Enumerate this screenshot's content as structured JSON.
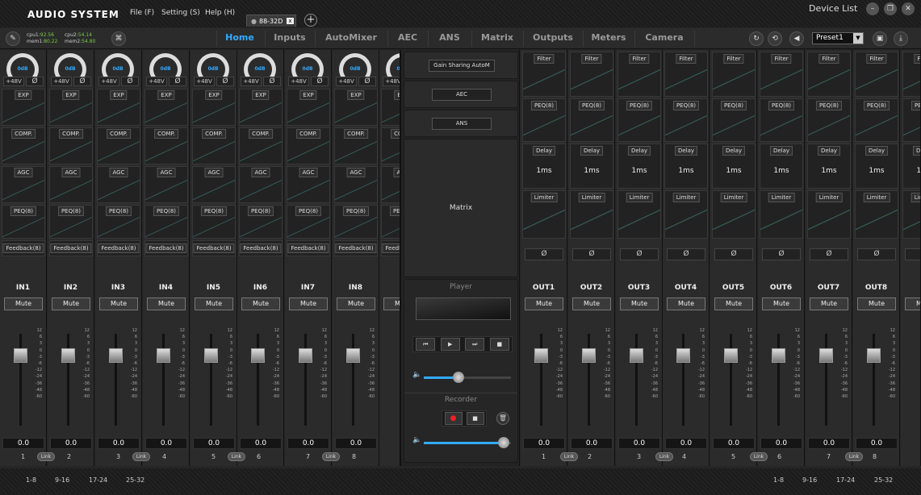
{
  "app": {
    "title": "AUDIO SYSTEM",
    "menu": [
      "File (F)",
      "Setting (S)",
      "Help (H)"
    ],
    "device_tab": "88-32D",
    "device_list": "Device List"
  },
  "toolbar": {
    "cpu1_label": "cpu1:",
    "cpu1": "92.56",
    "cpu2_label": "cpu2:",
    "cpu2": "54.14",
    "mem1_label": "mem1:",
    "mem1": "80.22",
    "mem2_label": "mem2:",
    "mem2": "54.80",
    "preset": "Preset1"
  },
  "nav": [
    "Home",
    "Inputs",
    "AutoMixer",
    "AEC",
    "ANS",
    "Matrix",
    "Outputs",
    "Meters",
    "Camera"
  ],
  "inputs": {
    "gain_label": "0dB",
    "phantom": "+48V",
    "phase": "Ø",
    "modules": [
      "EXP",
      "COMP.",
      "AGC",
      "PEQ(8)",
      "Feedback(8)"
    ],
    "mute": "Mute",
    "value": "0.0",
    "link": "Link",
    "channels": [
      "IN1",
      "IN2",
      "IN3",
      "IN4",
      "IN5",
      "IN6",
      "IN7",
      "IN8"
    ]
  },
  "outputs": {
    "modules": [
      "Filter",
      "PEQ(8)",
      "Delay",
      "Limiter"
    ],
    "delay_value": "1ms",
    "phase": "Ø",
    "mute": "Mute",
    "value": "0.0",
    "link": "Link",
    "channels": [
      "OUT1",
      "OUT2",
      "OUT3",
      "OUT4",
      "OUT5",
      "OUT6",
      "OUT7",
      "OUT8"
    ]
  },
  "fader_scale": [
    "12",
    "6",
    "3",
    "0",
    "-3",
    "-6",
    "-12",
    "-24",
    "-36",
    "-48",
    "-60"
  ],
  "numbers": [
    "1",
    "2",
    "3",
    "4",
    "5",
    "6",
    "7",
    "8"
  ],
  "center": {
    "gain_sharing": "Gain Sharing AutoM",
    "aec": "AEC",
    "ans": "ANS",
    "matrix": "Matrix",
    "player": "Player",
    "recorder": "Recorder",
    "player_volume": 0.4,
    "recorder_volume": 0.92
  },
  "pages": [
    "1-8",
    "9-16",
    "17-24",
    "25-32"
  ]
}
